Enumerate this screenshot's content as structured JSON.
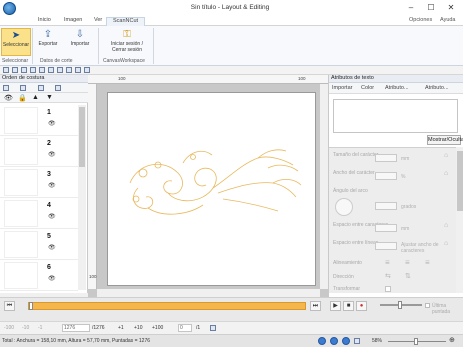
{
  "window": {
    "title": "Sin título - Layout & Editing",
    "minimize": "–",
    "maximize": "☐",
    "close": "✕"
  },
  "menu": {
    "tabs": [
      "Inicio",
      "Imagen",
      "Ver",
      "ScanNCut"
    ],
    "active_tab": "ScanNCut",
    "options": "Opciones",
    "help": "Ayuda"
  },
  "ribbon": {
    "buttons": [
      {
        "label": "Seleccionar",
        "selected": true
      },
      {
        "label": "Exportar"
      },
      {
        "label": "Importar"
      },
      {
        "label": "Iniciar sesión / Cerrar sesión"
      }
    ],
    "groups": [
      "Seleccionar",
      "Datos de corte",
      "CanvasWorkspace"
    ]
  },
  "left_panel": {
    "title": "Orden de costura",
    "items": [
      {
        "num": "1"
      },
      {
        "num": "2"
      },
      {
        "num": "3"
      },
      {
        "num": "4"
      },
      {
        "num": "5"
      },
      {
        "num": "6"
      }
    ]
  },
  "canvas": {
    "ruler_top": [
      "100",
      "100"
    ],
    "ruler_left": [
      "100"
    ]
  },
  "right_panel": {
    "title": "Atributos de texto",
    "tabs": [
      "Importar",
      "Color",
      "Atributo...",
      "Atributo..."
    ],
    "show_button": "Mostrar/Ocultar",
    "properties": [
      {
        "label": "Tamaño del carácter",
        "unit": "mm"
      },
      {
        "label": "Ancho del carácter",
        "unit": "%"
      },
      {
        "label": "Ángulo del arco",
        "unit": "grados"
      },
      {
        "label": "Espacio entre caracteres",
        "unit": "mm"
      },
      {
        "label": "Espacio entre líneas",
        "unit": "Ajustar ancho de caracteres"
      },
      {
        "label": "Alineamiento",
        "unit": ""
      },
      {
        "label": "Dirección",
        "unit": ""
      },
      {
        "label": "Transformar",
        "unit": ""
      }
    ]
  },
  "player": {
    "progress": 0.02,
    "play": "▶",
    "stop": "■",
    "record": "●",
    "last_stitch": "Última puntada"
  },
  "bottom_bar": {
    "values": [
      "1276",
      "1276",
      "100",
      "0",
      "1"
    ],
    "labels": [
      "-100",
      "-10",
      "-1",
      "+1",
      "+10",
      "+100",
      "/1"
    ]
  },
  "status": {
    "text": "Total : Anchura = 158,10 mm, Altura = 57,70 mm, Puntadas = 1276",
    "zoom": "58%"
  },
  "colors": {
    "accent": "#f5b64b",
    "ribbon_selected": "#fbe28a",
    "design_stroke": "#e8b85c"
  }
}
